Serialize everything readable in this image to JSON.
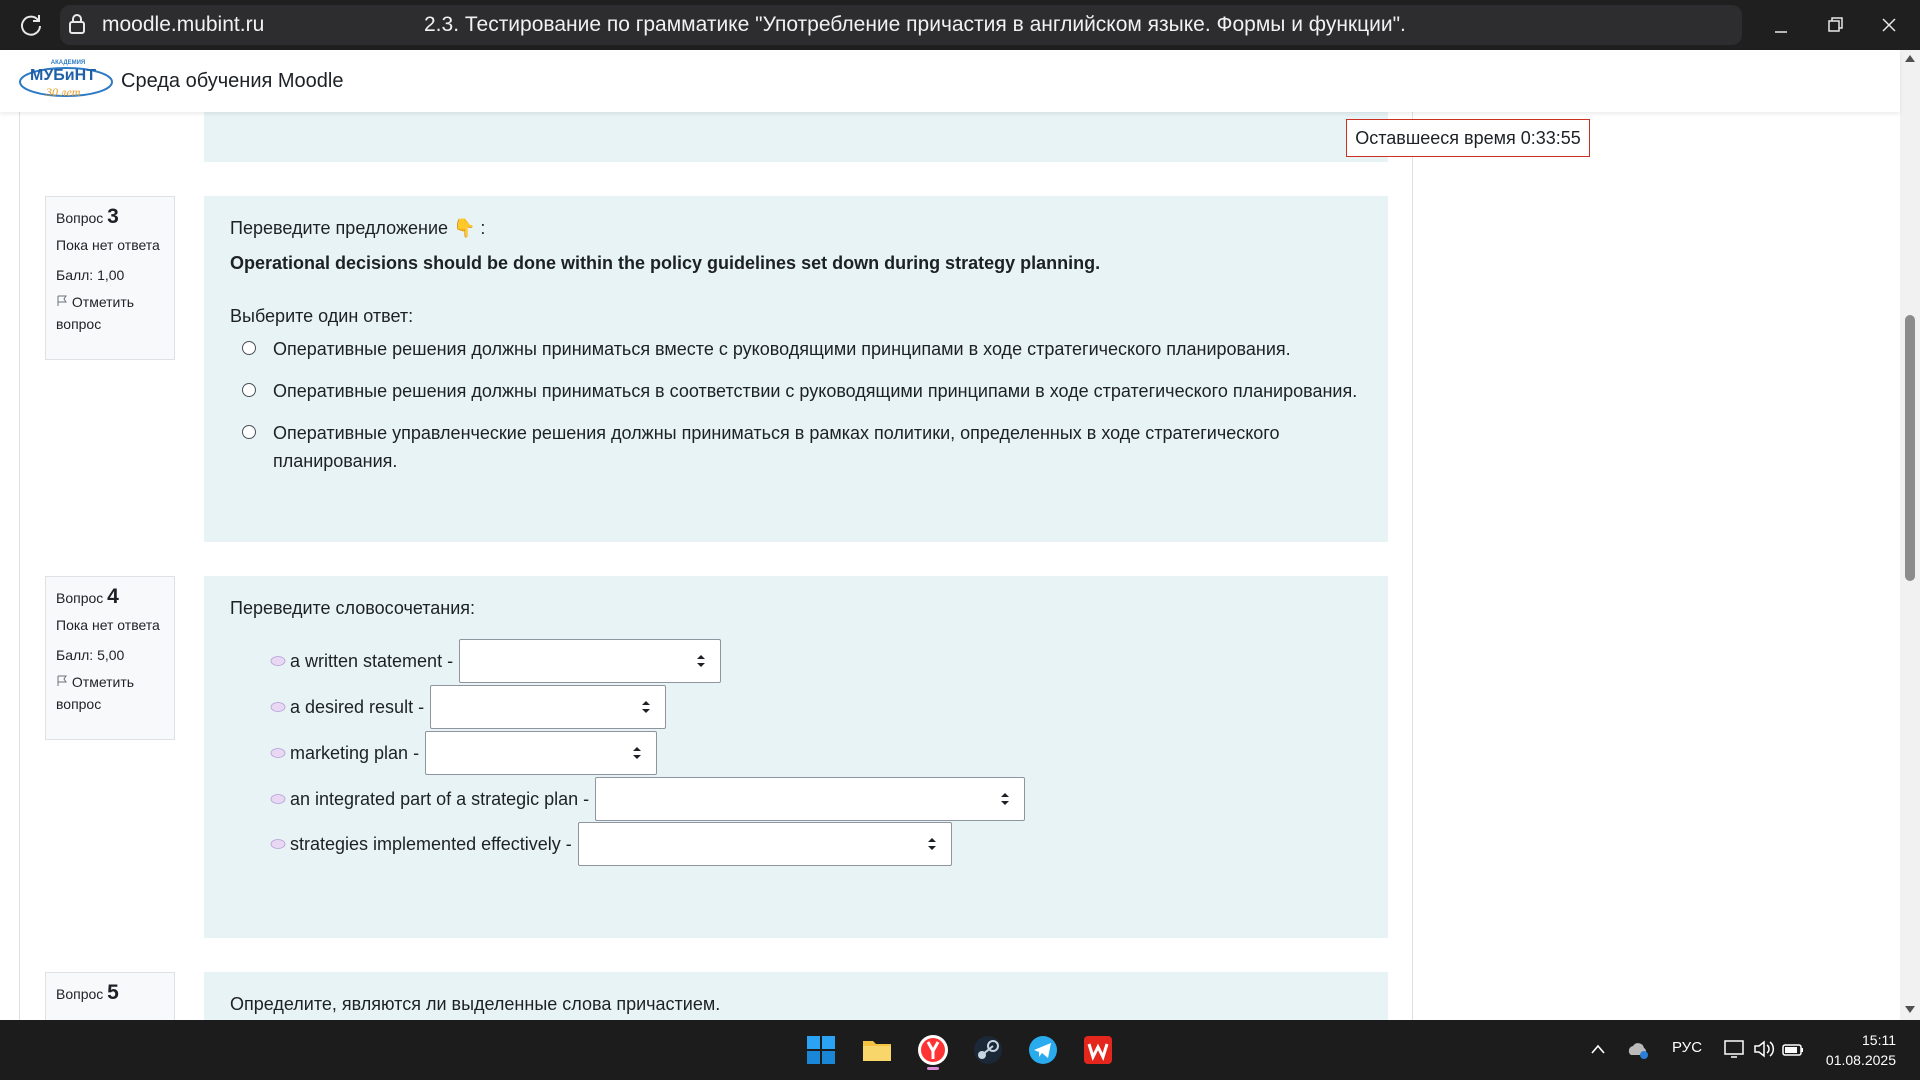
{
  "browser": {
    "url": "moodle.mubint.ru",
    "tab_title": "2.3. Тестирование по грамматике \"Употребление причастия в английском языке. Формы и функции\"."
  },
  "header": {
    "logo_text": "МУБиНТ",
    "site_name": "Среда обучения Moodle"
  },
  "timer": {
    "text": "Оставшееся время 0:33:55"
  },
  "questions": [
    {
      "label": "Вопрос",
      "number": "3",
      "status": "Пока нет ответа",
      "score": "Балл: 1,00",
      "flag_label": "Отметить вопрос",
      "intro": "Переведите предложение 👇 :",
      "sentence": "Operational decisions should be done within the policy guidelines set down during strategy planning.",
      "prompt": "Выберите один ответ:",
      "options": [
        "Оперативные решения должны приниматься вместе с руководящими принципами в ходе стратегического планирования.",
        "Оперативные решения должны приниматься в соответствии с руководящими принципами в ходе стратегического планирования.",
        "Оперативные управленческие решения должны приниматься в рамках политики, определенных в ходе стратегического планирования."
      ]
    },
    {
      "label": "Вопрос",
      "number": "4",
      "status": "Пока нет ответа",
      "score": "Балл: 5,00",
      "flag_label": "Отметить вопрос",
      "intro": "Переведите словосочетания:",
      "items": [
        "a written statement -",
        "a desired result -",
        "marketing plan -",
        "an integrated part of a strategic plan -",
        "strategies implemented effectively -"
      ]
    },
    {
      "label": "Вопрос",
      "number": "5",
      "intro": "Определите, являются ли выделенные слова причастием."
    }
  ],
  "taskbar": {
    "language": "РУС",
    "time": "15:11",
    "date": "01.08.2025"
  },
  "colors": {
    "question_bg": "#e7f3f5",
    "timer_border": "#ca3120",
    "taskbar_bg": "#1c1c1c"
  }
}
